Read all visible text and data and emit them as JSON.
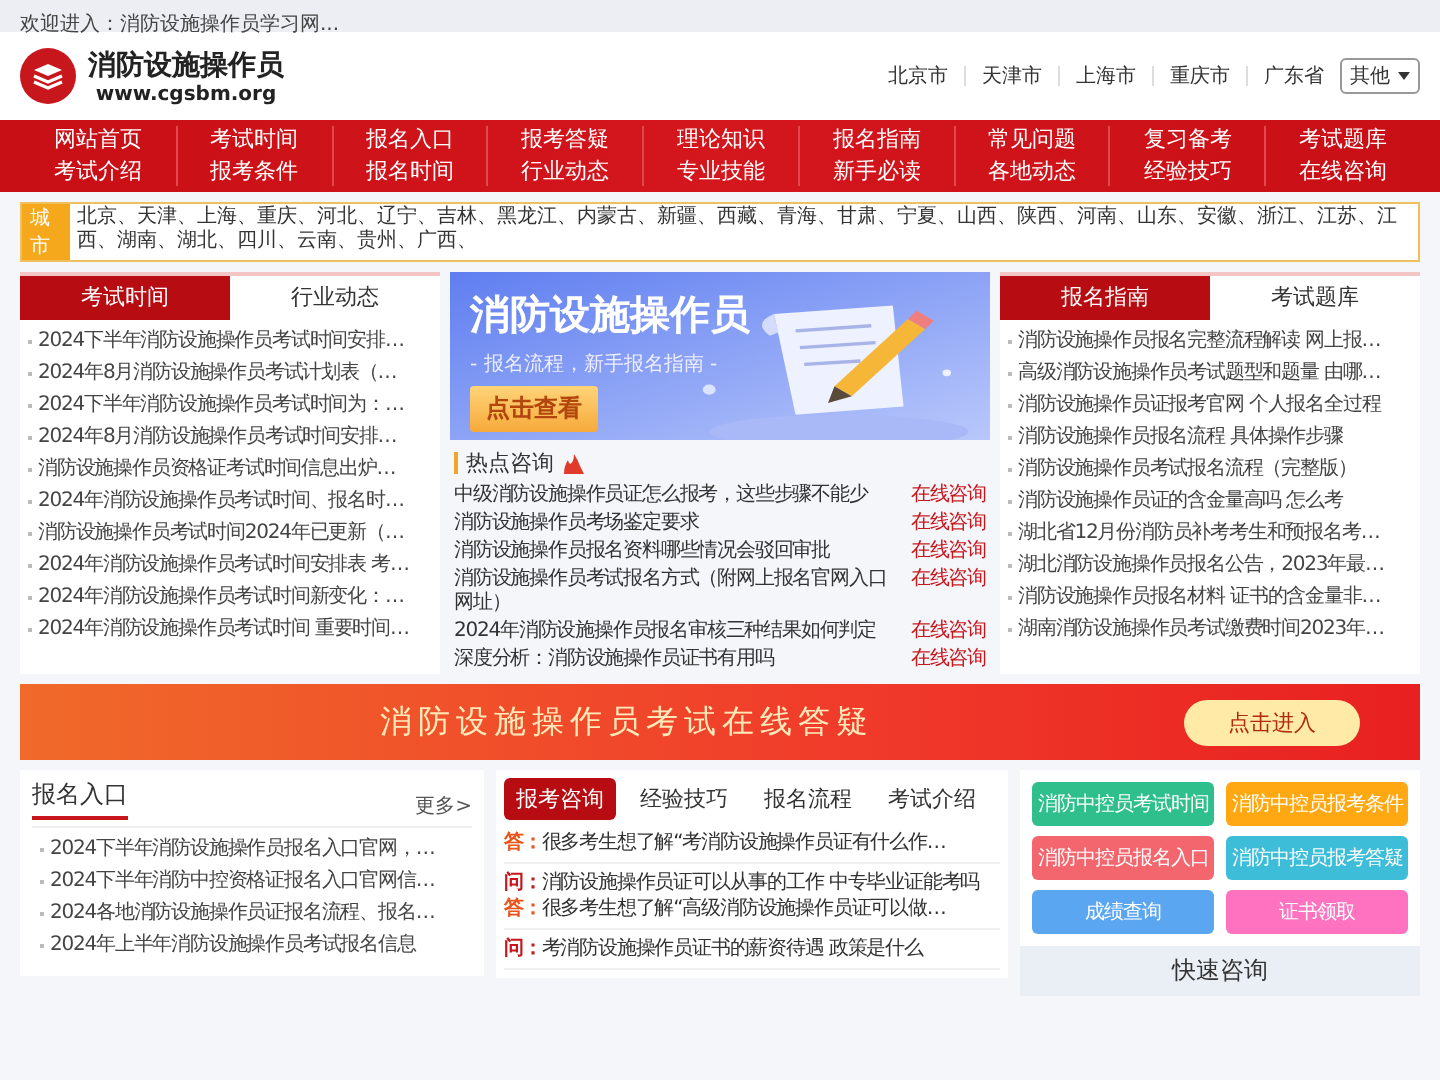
{
  "top_bar": {
    "welcome": "欢迎进入：消防设施操作员学习网..."
  },
  "header": {
    "site_name": "消防设施操作员",
    "url": "www.cgsbm.org",
    "cities": [
      "北京市",
      "天津市",
      "上海市",
      "重庆市",
      "广东省"
    ],
    "city_select": "其他"
  },
  "nav": [
    {
      "top": "网站首页",
      "bottom": "考试介绍"
    },
    {
      "top": "考试时间",
      "bottom": "报考条件"
    },
    {
      "top": "报名入口",
      "bottom": "报名时间"
    },
    {
      "top": "报考答疑",
      "bottom": "行业动态"
    },
    {
      "top": "理论知识",
      "bottom": "专业技能"
    },
    {
      "top": "报名指南",
      "bottom": "新手必读"
    },
    {
      "top": "常见问题",
      "bottom": "各地动态"
    },
    {
      "top": "复习备考",
      "bottom": "经验技巧"
    },
    {
      "top": "考试题库",
      "bottom": "在线咨询"
    }
  ],
  "city_bar": {
    "label": "城市",
    "cities": "北京、天津、上海、重庆、河北、辽宁、吉林、黑龙江、内蒙古、新疆、西藏、青海、甘肃、宁夏、山西、陕西、河南、山东、安徽、浙江、江苏、江西、湖南、湖北、四川、云南、贵州、广西、"
  },
  "left_panel": {
    "tabs": [
      {
        "label": "考试时间",
        "selected": true
      },
      {
        "label": "行业动态",
        "selected": false
      }
    ],
    "items": [
      "2024下半年消防设施操作员考试时间安排…",
      "2024年8月消防设施操作员考试计划表（…",
      "2024下半年消防设施操作员考试时间为：…",
      "2024年8月消防设施操作员考试时间安排…",
      "消防设施操作员资格证考试时间信息出炉…",
      "2024年消防设施操作员考试时间、报名时…",
      "消防设施操作员考试时间2024年已更新（…",
      "2024年消防设施操作员考试时间安排表 考…",
      "2024年消防设施操作员考试时间新变化：…",
      "2024年消防设施操作员考试时间 重要时间…"
    ]
  },
  "feature_banner": {
    "title": "消防设施操作员",
    "subtitle": "- 报名流程，新手报名指南 -",
    "button": "点击查看"
  },
  "hot": {
    "title": "热点咨询",
    "rows": [
      {
        "text": "中级消防设施操作员证怎么报考，这些步骤不能少",
        "action": "在线咨询"
      },
      {
        "text": "消防设施操作员考场鉴定要求",
        "action": "在线咨询"
      },
      {
        "text": "消防设施操作员报名资料哪些情况会驳回审批",
        "action": "在线咨询"
      },
      {
        "text": "消防设施操作员考试报名方式（附网上报名官网入口网址）",
        "action": "在线咨询"
      },
      {
        "text": "2024年消防设施操作员报名审核三种结果如何判定",
        "action": "在线咨询"
      },
      {
        "text": "深度分析：消防设施操作员证书有用吗",
        "action": "在线咨询"
      }
    ]
  },
  "right_panel": {
    "tabs": [
      {
        "label": "报名指南",
        "selected": true
      },
      {
        "label": "考试题库",
        "selected": false
      }
    ],
    "items": [
      "消防设施操作员报名完整流程解读 网上报…",
      "高级消防设施操作员考试题型和题量 由哪…",
      "消防设施操作员证报考官网 个人报名全过程",
      "消防设施操作员报名流程 具体操作步骤",
      "消防设施操作员考试报名流程（完整版）",
      "消防设施操作员证的含金量高吗 怎么考",
      "湖北省12月份消防员补考考生和预报名考…",
      "湖北消防设施操作员报名公告，2023年最…",
      "消防设施操作员报名材料 证书的含金量非…",
      "湖南消防设施操作员考试缴费时间2023年…"
    ]
  },
  "promo_banner": {
    "title": "消防设施操作员考试在线答疑",
    "button": "点击进入"
  },
  "entry_card": {
    "title": "报名入口",
    "more": "更多>",
    "items": [
      "2024下半年消防设施操作员报名入口官网，…",
      "2024下半年消防中控资格证报名入口官网信…",
      "2024各地消防设施操作员证报名流程、报名…",
      "2024年上半年消防设施操作员考试报名信息"
    ]
  },
  "qa_panel": {
    "tabs": [
      {
        "label": "报考咨询",
        "selected": true
      },
      {
        "label": "经验技巧",
        "selected": false
      },
      {
        "label": "报名流程",
        "selected": false
      },
      {
        "label": "考试介绍",
        "selected": false
      }
    ],
    "groups": [
      {
        "entries": [
          {
            "kind": "answer",
            "marker": "答：",
            "text": "很多考生想了解“考消防设施操作员证有什么作…"
          }
        ]
      },
      {
        "entries": [
          {
            "kind": "question",
            "marker": "问：",
            "text": "消防设施操作员证可以从事的工作 中专毕业证能考吗"
          },
          {
            "kind": "answer",
            "marker": "答：",
            "text": "很多考生想了解“高级消防设施操作员证可以做…"
          }
        ]
      },
      {
        "entries": [
          {
            "kind": "question",
            "marker": "问：",
            "text": "考消防设施操作员证书的薪资待遇 政策是什么"
          }
        ]
      }
    ]
  },
  "quick_links": [
    {
      "label": "消防中控员考试时间",
      "color": "#2ebf8c"
    },
    {
      "label": "消防中控员报考条件",
      "color": "#ffa812"
    },
    {
      "label": "消防中控员报名入口",
      "color": "#f4666e"
    },
    {
      "label": "消防中控员报考答疑",
      "color": "#3dbdd8"
    },
    {
      "label": "成绩查询",
      "color": "#5ba6f1"
    },
    {
      "label": "证书领取",
      "color": "#ff72c0"
    }
  ],
  "quick_consult": {
    "title": "快速咨询"
  }
}
